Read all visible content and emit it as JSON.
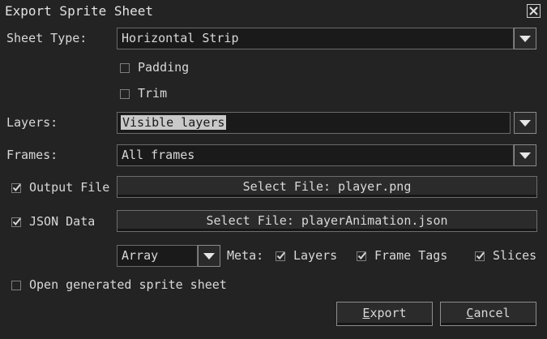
{
  "dialog": {
    "title": "Export Sprite Sheet",
    "close_icon": "close-icon"
  },
  "sheet_type": {
    "label": "Sheet Type:",
    "value": "Horizontal Strip"
  },
  "padding": {
    "label": "Padding",
    "checked": false
  },
  "trim": {
    "label": "Trim",
    "checked": false
  },
  "layers": {
    "label": "Layers:",
    "value": "Visible layers"
  },
  "frames": {
    "label": "Frames:",
    "value": "All frames"
  },
  "output_file": {
    "label": "Output File",
    "checked": true,
    "button_label": "Select File: player.png"
  },
  "json_data": {
    "label": "JSON Data",
    "checked": true,
    "button_label": "Select File: playerAnimation.json"
  },
  "format": {
    "value": "Array"
  },
  "meta": {
    "label": "Meta:",
    "layers": {
      "label": "Layers",
      "checked": true
    },
    "frame_tags": {
      "label": "Frame Tags",
      "checked": true
    },
    "slices": {
      "label": "Slices",
      "checked": true
    }
  },
  "open_generated": {
    "label": "Open generated sprite sheet",
    "checked": false
  },
  "buttons": {
    "export_mnemonic": "E",
    "export_rest": "xport",
    "cancel_mnemonic": "C",
    "cancel_rest": "ancel"
  }
}
